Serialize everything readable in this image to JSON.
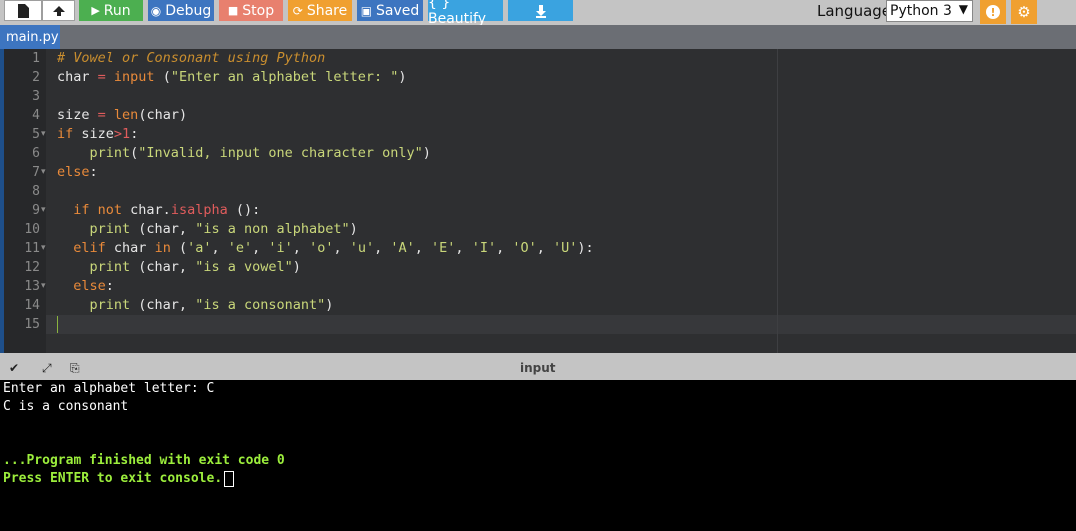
{
  "toolbar": {
    "new_icon": "file-icon",
    "upload_icon": "upload-icon",
    "run_label": "Run",
    "debug_label": "Debug",
    "stop_label": "Stop",
    "share_label": "Share",
    "saved_label": "Saved",
    "beautify_label": "{ } Beautify",
    "download_icon": "download-icon",
    "language_label": "Language",
    "language_value": "Python 3",
    "info_icon": "info-icon",
    "settings_icon": "gear-icon",
    "colors": {
      "run": "#4caf50",
      "debug": "#3d75c0",
      "stop": "#e8806e",
      "share": "#f0a030",
      "saved": "#3d75c0",
      "beautify": "#3aa3e0",
      "download": "#3aa3e0"
    }
  },
  "tab": {
    "filename": "main.py"
  },
  "editor": {
    "line_numbers": [
      "1",
      "2",
      "3",
      "4",
      "5",
      "6",
      "7",
      "8",
      "9",
      "10",
      "11",
      "12",
      "13",
      "14",
      "15"
    ],
    "fold_marker": "▾"
  },
  "console": {
    "title": "input",
    "lines": [
      "Enter an alphabet letter: C",
      "C is a consonant",
      "",
      "",
      "...Program finished with exit code 0",
      "Press ENTER to exit console."
    ]
  }
}
